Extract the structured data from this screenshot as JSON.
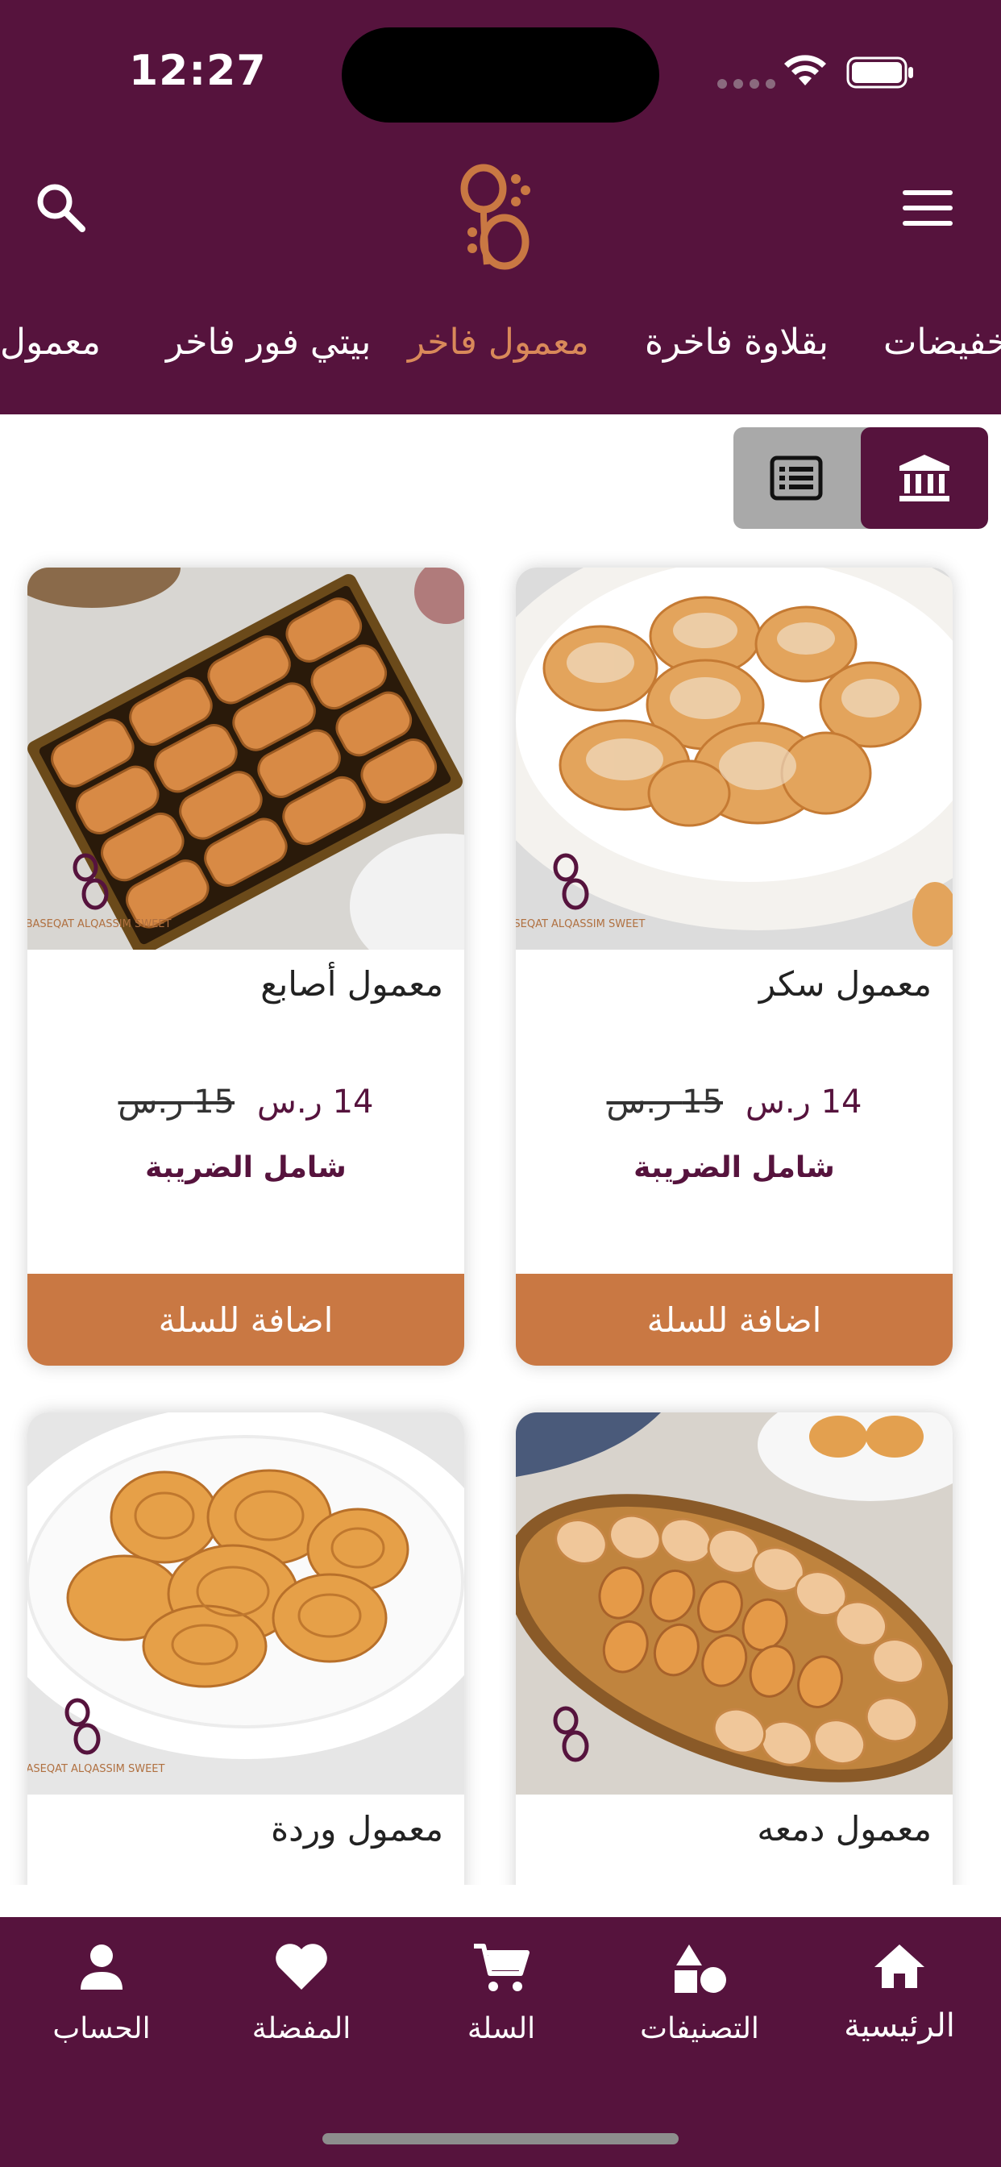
{
  "status_bar": {
    "time": "12:27"
  },
  "header": {
    "categories": [
      {
        "label": "معمول",
        "active": false
      },
      {
        "label": "بيتي فور فاخر",
        "active": false
      },
      {
        "label": "معمول فاخر",
        "active": true
      },
      {
        "label": "بقلاوة فاخرة",
        "active": false
      },
      {
        "label": "تخفيضات",
        "active": false
      }
    ]
  },
  "view_toggle": {
    "selected": "grid"
  },
  "products": [
    {
      "name": "معمول سكر",
      "price": "14 ر.س",
      "old_price": "15 ر.س",
      "tax_note": "شامل الضريبة",
      "add_label": "اضافة للسلة"
    },
    {
      "name": "معمول أصابع",
      "price": "14 ر.س",
      "old_price": "15 ر.س",
      "tax_note": "شامل الضريبة",
      "add_label": "اضافة للسلة"
    },
    {
      "name": "معمول دمعه"
    },
    {
      "name": "معمول وردة"
    }
  ],
  "tabbar": {
    "items": [
      {
        "label": "الرئيسية",
        "icon": "home-icon"
      },
      {
        "label": "التصنيفات",
        "icon": "categories-icon"
      },
      {
        "label": "السلة",
        "icon": "cart-icon"
      },
      {
        "label": "المفضلة",
        "icon": "heart-icon"
      },
      {
        "label": "الحساب",
        "icon": "person-icon"
      }
    ]
  },
  "colors": {
    "brand": "#56133d",
    "accent": "#c97843",
    "active_category": "#d9895a"
  }
}
